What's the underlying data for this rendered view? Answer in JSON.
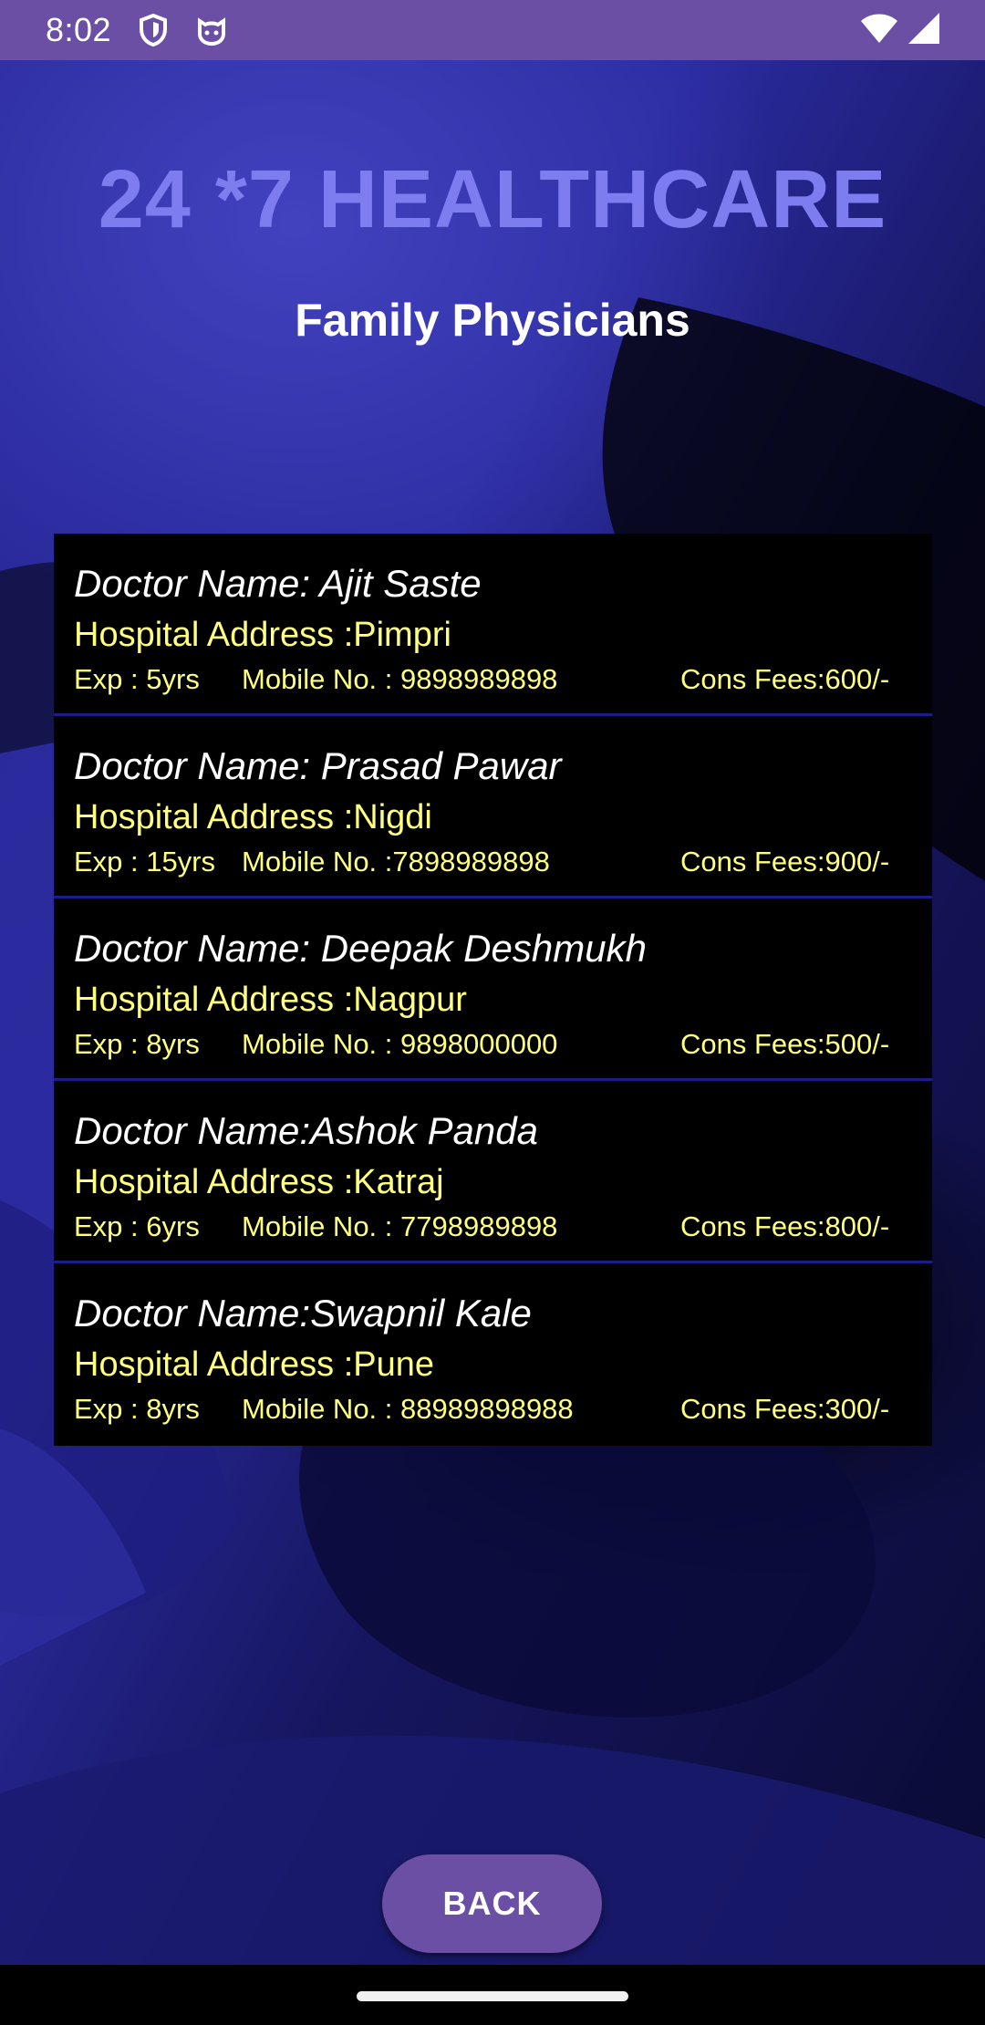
{
  "status_bar": {
    "time": "8:02",
    "left_icons": [
      "shield-icon",
      "cat-face-icon"
    ],
    "right_icons": [
      "wifi-icon",
      "signal-icon"
    ],
    "background_color": "#6a4fa5"
  },
  "header": {
    "app_title": "24 *7 HEALTHCARE",
    "subtitle": "Family Physicians",
    "title_color": "#7d7df0"
  },
  "doctors": [
    {
      "name": "Doctor Name: Ajit Saste",
      "address": "Hospital Address :Pimpri",
      "experience": "Exp : 5yrs",
      "mobile": "Mobile No. : 9898989898",
      "fees": "Cons Fees:600/-"
    },
    {
      "name": "Doctor Name: Prasad Pawar",
      "address": "Hospital Address :Nigdi",
      "experience": "Exp : 15yrs",
      "mobile": "Mobile No. :7898989898",
      "fees": "Cons Fees:900/-"
    },
    {
      "name": "Doctor Name: Deepak Deshmukh",
      "address": "Hospital Address :Nagpur",
      "experience": "Exp : 8yrs",
      "mobile": "Mobile No. : 9898000000",
      "fees": "Cons Fees:500/-"
    },
    {
      "name": "Doctor Name:Ashok Panda",
      "address": "Hospital Address :Katraj",
      "experience": "Exp : 6yrs",
      "mobile": "Mobile No. : 7798989898",
      "fees": "Cons Fees:800/-"
    },
    {
      "name": "Doctor Name:Swapnil Kale",
      "address": "Hospital Address :Pune",
      "experience": "Exp : 8yrs",
      "mobile": "Mobile No. : 88989898988",
      "fees": "Cons Fees:300/-"
    }
  ],
  "actions": {
    "back_label": "BACK",
    "button_color": "#6a4fa5"
  },
  "colors": {
    "detail_text": "#ffff80",
    "name_text": "#ffffff",
    "card_background": "#000000"
  }
}
